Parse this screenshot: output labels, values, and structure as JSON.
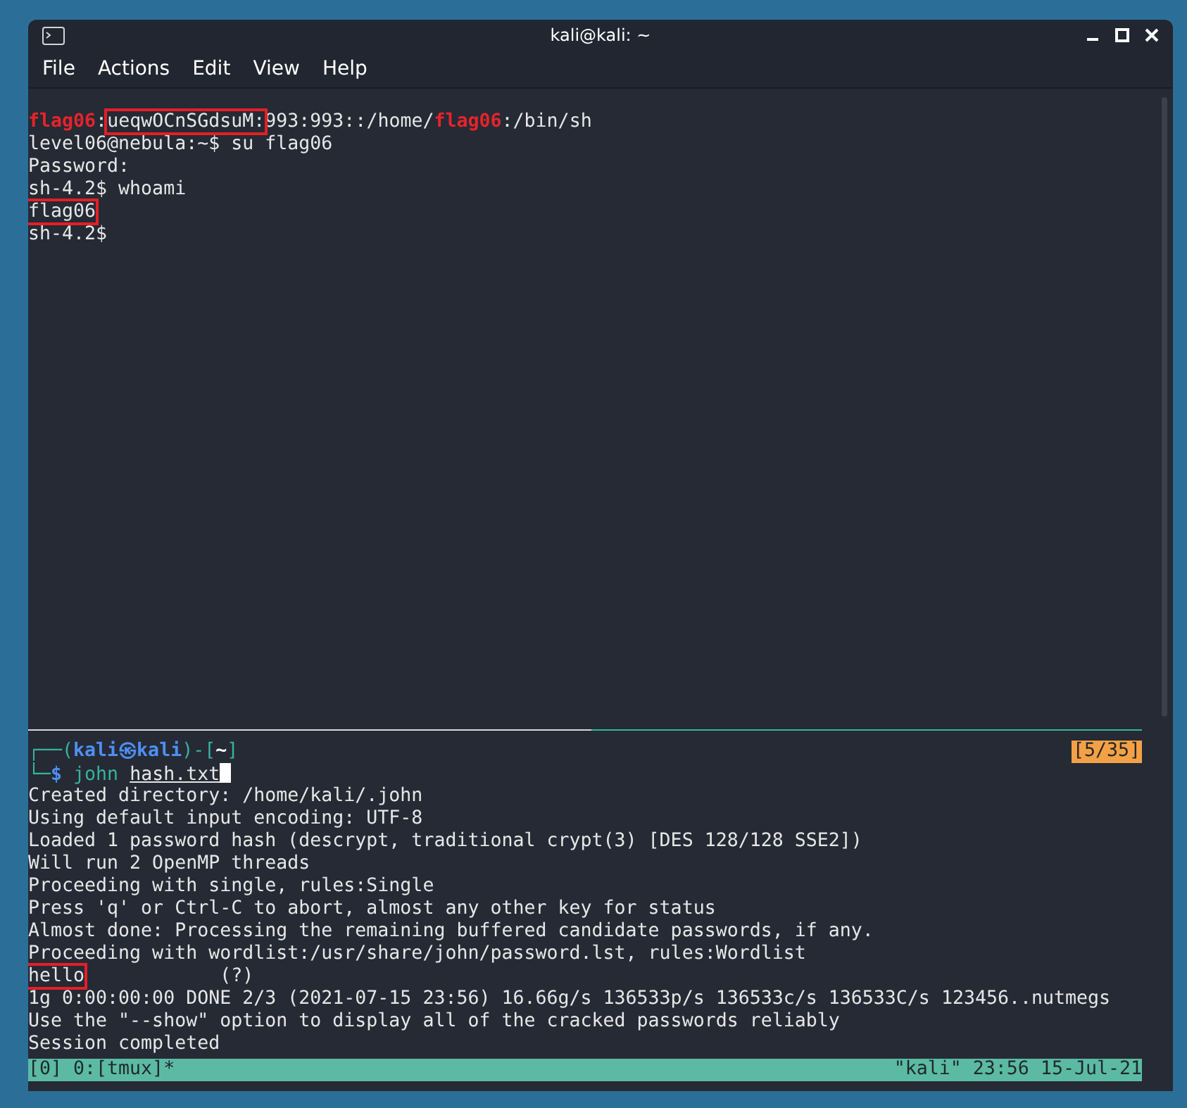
{
  "window": {
    "title": "kali@kali: ~"
  },
  "menu": [
    "File",
    "Actions",
    "Edit",
    "View",
    "Help"
  ],
  "top_pane": {
    "lines": [
      [
        {
          "text": "flag06",
          "kind": "user"
        },
        {
          "text": ":",
          "kind": "plain"
        },
        {
          "text": "ueqwOCnSGdsuM:",
          "kind": "boxed"
        },
        {
          "text": "993:993::/home/",
          "kind": "plain"
        },
        {
          "text": "flag06",
          "kind": "user"
        },
        {
          "text": ":/bin/sh",
          "kind": "plain"
        }
      ],
      [
        {
          "text": "level06@nebula:~$ su flag06",
          "kind": "plain"
        }
      ],
      [
        {
          "text": "Password:",
          "kind": "plain"
        }
      ],
      [
        {
          "text": "sh-4.2$ whoami",
          "kind": "plain"
        }
      ],
      [
        {
          "text": "flag06",
          "kind": "boxed"
        }
      ],
      [
        {
          "text": "sh-4.2$",
          "kind": "plain"
        }
      ]
    ]
  },
  "bottom_pane": {
    "badge": "[5/35]",
    "lines": [
      [
        {
          "text": "┌──(",
          "kind": "frame"
        },
        {
          "text": "kali㉿kali",
          "kind": "host"
        },
        {
          "text": ")-[",
          "kind": "frame"
        },
        {
          "text": "~",
          "kind": "dir"
        },
        {
          "text": "]",
          "kind": "frame"
        }
      ],
      [
        {
          "text": "└─",
          "kind": "frame"
        },
        {
          "text": "$",
          "kind": "host"
        },
        {
          "text": " john ",
          "kind": "command"
        },
        {
          "text": "hash.txt",
          "kind": "path-arg"
        }
      ],
      [
        {
          "text": "Created directory: /home/kali/.john",
          "kind": "plain"
        }
      ],
      [
        {
          "text": "Using default input encoding: UTF-8",
          "kind": "plain"
        }
      ],
      [
        {
          "text": "Loaded 1 password hash (descrypt, traditional crypt(3) [DES 128/128 SSE2])",
          "kind": "plain"
        }
      ],
      [
        {
          "text": "Will run 2 OpenMP threads",
          "kind": "plain"
        }
      ],
      [
        {
          "text": "Proceeding with single, rules:Single",
          "kind": "plain"
        }
      ],
      [
        {
          "text": "Press 'q' or Ctrl-C to abort, almost any other key for status",
          "kind": "plain"
        }
      ],
      [
        {
          "text": "Almost done: Processing the remaining buffered candidate passwords, if any.",
          "kind": "plain"
        }
      ],
      [
        {
          "text": "Proceeding with wordlist:/usr/share/john/password.lst, rules:Wordlist",
          "kind": "plain"
        }
      ],
      [
        {
          "text": "hello",
          "kind": "boxed"
        },
        {
          "text": "            (?)",
          "kind": "plain"
        }
      ],
      [
        {
          "text": "1g 0:00:00:00 DONE 2/3 (2021-07-15 23:56) 16.66g/s 136533p/s 136533c/s 136533C/s 123456..nutmegs",
          "kind": "plain"
        }
      ],
      [
        {
          "text": "Use the \"--show\" option to display all of the cracked passwords reliably",
          "kind": "plain"
        }
      ],
      [
        {
          "text": "Session completed",
          "kind": "plain"
        }
      ]
    ]
  },
  "status_bar": {
    "left": "[0] 0:[tmux]*",
    "right": "\"kali\" 23:56 15-Jul-21"
  }
}
